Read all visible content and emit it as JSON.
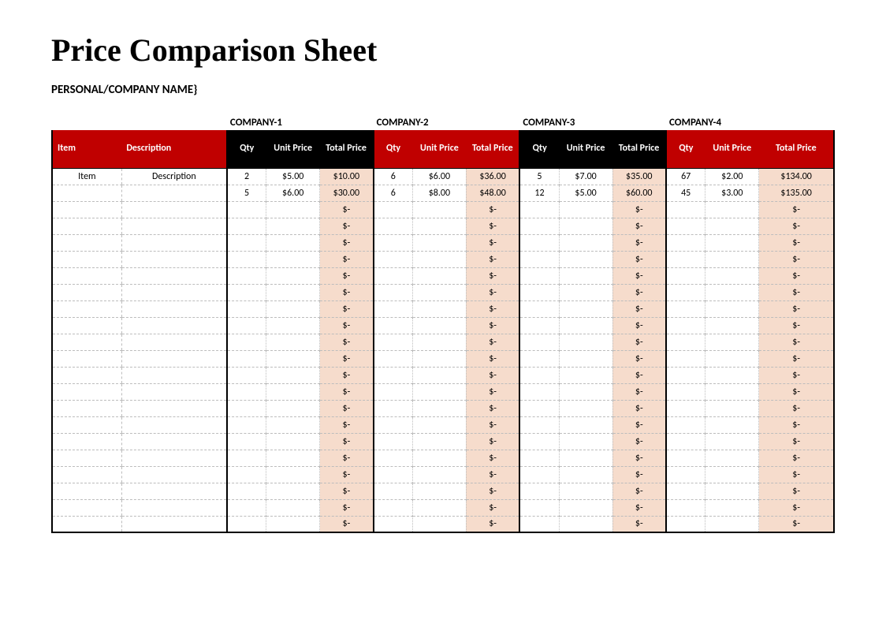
{
  "title": "Price Comparison Sheet",
  "subtitle": "PERSONAL/COMPANY NAME}",
  "headers": {
    "item": "Item",
    "description": "Description",
    "qty": "Qty",
    "unit_price": "Unit Price",
    "total_price": "Total Price"
  },
  "companies": [
    "COMPANY-1",
    "COMPANY-2",
    "COMPANY-3",
    "COMPANY-4"
  ],
  "empty_total": "$-",
  "rows": [
    {
      "item": "Item",
      "description": "Description",
      "c1": {
        "qty": "2",
        "unit": "$5.00",
        "total": "$10.00"
      },
      "c2": {
        "qty": "6",
        "unit": "$6.00",
        "total": "$36.00"
      },
      "c3": {
        "qty": "5",
        "unit": "$7.00",
        "total": "$35.00"
      },
      "c4": {
        "qty": "67",
        "unit": "$2.00",
        "total": "$134.00"
      }
    },
    {
      "item": "",
      "description": "",
      "c1": {
        "qty": "5",
        "unit": "$6.00",
        "total": "$30.00"
      },
      "c2": {
        "qty": "6",
        "unit": "$8.00",
        "total": "$48.00"
      },
      "c3": {
        "qty": "12",
        "unit": "$5.00",
        "total": "$60.00"
      },
      "c4": {
        "qty": "45",
        "unit": "$3.00",
        "total": "$135.00"
      }
    }
  ],
  "empty_row_count": 20
}
